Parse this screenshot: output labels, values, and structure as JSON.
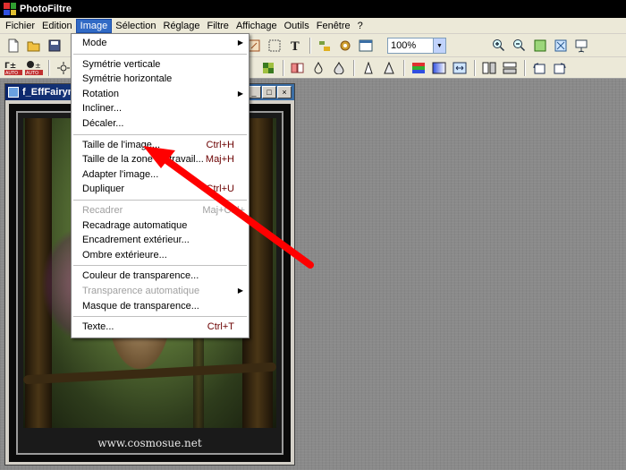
{
  "app": {
    "title": "PhotoFiltre"
  },
  "menubar": {
    "items": [
      "Fichier",
      "Edition",
      "Image",
      "Sélection",
      "Réglage",
      "Filtre",
      "Affichage",
      "Outils",
      "Fenêtre",
      "?"
    ],
    "active": "Image"
  },
  "toolbar": {
    "zoom_value": "100%"
  },
  "image_window": {
    "title": "f_EffFairym"
  },
  "image_caption": "www.cosmosue.net",
  "image_menu": {
    "items": [
      {
        "label": "Mode",
        "shortcut": "",
        "submenu": true,
        "disabled": false
      },
      {
        "separator": true
      },
      {
        "label": "Symétrie verticale",
        "shortcut": "",
        "submenu": false,
        "disabled": false
      },
      {
        "label": "Symétrie horizontale",
        "shortcut": "",
        "submenu": false,
        "disabled": false
      },
      {
        "label": "Rotation",
        "shortcut": "",
        "submenu": true,
        "disabled": false
      },
      {
        "label": "Incliner...",
        "shortcut": "",
        "submenu": false,
        "disabled": false
      },
      {
        "label": "Décaler...",
        "shortcut": "",
        "submenu": false,
        "disabled": false
      },
      {
        "separator": true
      },
      {
        "label": "Taille de l'image...",
        "shortcut": "Ctrl+H",
        "submenu": false,
        "disabled": false
      },
      {
        "label": "Taille de la zone de travail...",
        "shortcut": "Maj+H",
        "submenu": false,
        "disabled": false
      },
      {
        "label": "Adapter l'image...",
        "shortcut": "",
        "submenu": false,
        "disabled": false
      },
      {
        "label": "Dupliquer",
        "shortcut": "Ctrl+U",
        "submenu": false,
        "disabled": false
      },
      {
        "separator": true
      },
      {
        "label": "Recadrer",
        "shortcut": "Maj+Ctrl+",
        "submenu": false,
        "disabled": true
      },
      {
        "label": "Recadrage automatique",
        "shortcut": "",
        "submenu": false,
        "disabled": false
      },
      {
        "label": "Encadrement extérieur...",
        "shortcut": "",
        "submenu": false,
        "disabled": false
      },
      {
        "label": "Ombre extérieure...",
        "shortcut": "",
        "submenu": false,
        "disabled": false
      },
      {
        "separator": true
      },
      {
        "label": "Couleur de transparence...",
        "shortcut": "",
        "submenu": false,
        "disabled": false
      },
      {
        "label": "Transparence automatique",
        "shortcut": "",
        "submenu": true,
        "disabled": true
      },
      {
        "label": "Masque de transparence...",
        "shortcut": "",
        "submenu": false,
        "disabled": false
      },
      {
        "separator": true
      },
      {
        "label": "Texte...",
        "shortcut": "Ctrl+T",
        "submenu": false,
        "disabled": false
      }
    ]
  },
  "colors": {
    "menu_highlight": "#316ac5",
    "arrow": "#ff0000",
    "shortcut": "#6b0000",
    "titlebar": "#000000"
  }
}
